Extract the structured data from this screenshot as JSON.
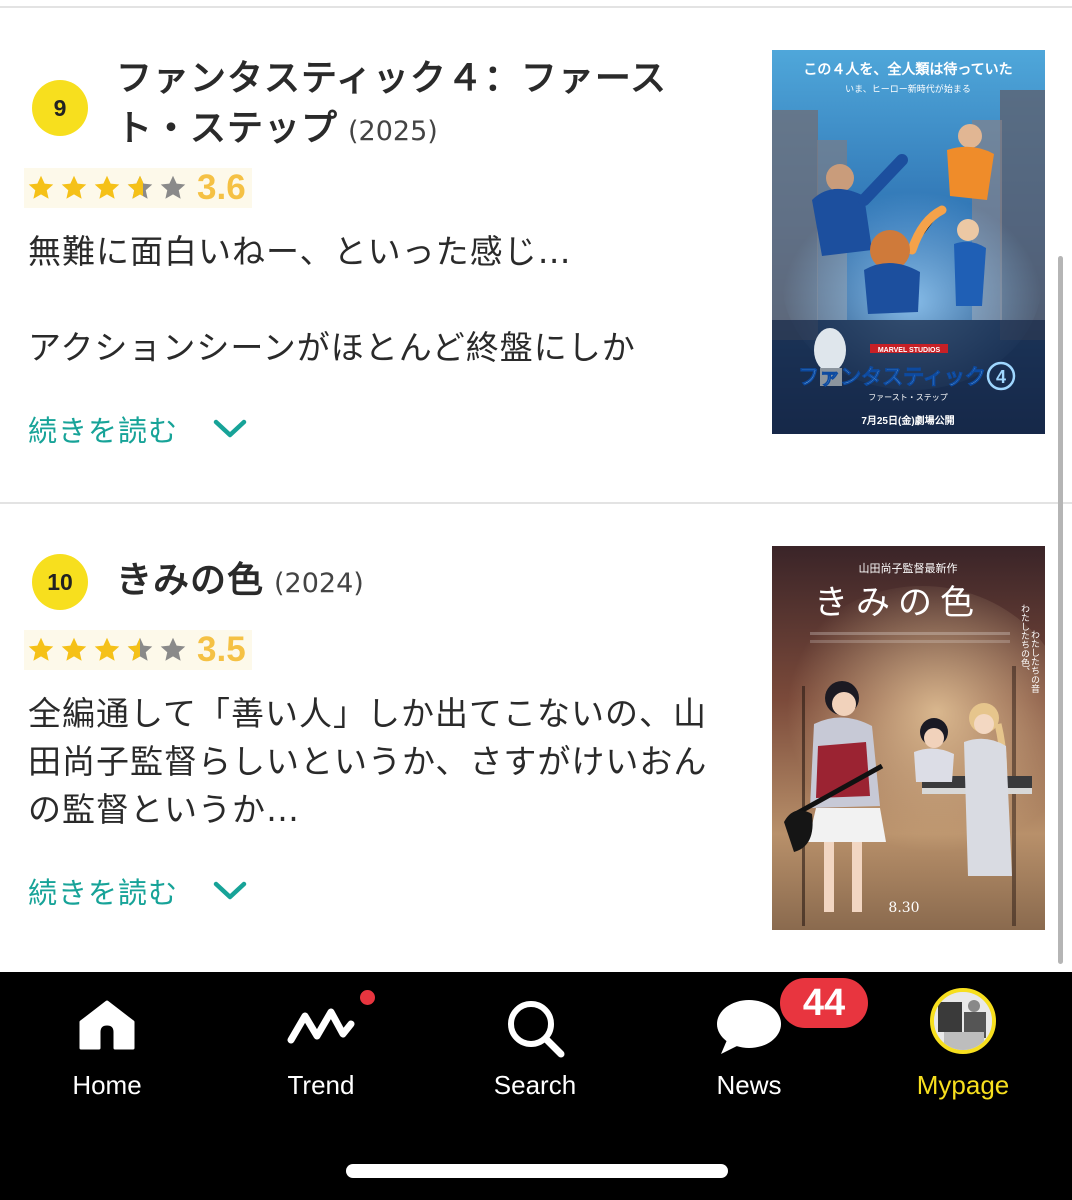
{
  "items": [
    {
      "rank": "9",
      "title": "ファンタスティック４：ファースト・ステップ",
      "year": "(2025)",
      "rating": {
        "score": "3.6",
        "value": 3.6,
        "max": 5
      },
      "review": "無難に面白いねー、といった感じ…\n\nアクションシーンがほとんど終盤にしか",
      "read_more": "続きを読む",
      "poster": {
        "tagline": "この４人を、全人類は待っていた",
        "subtagline": "いま、ヒーロー新時代が始まる",
        "brand": "MARVEL STUDIOS",
        "logo_text": "ファンタスティック",
        "logo_number": "4",
        "subtitle": "ファースト・ステップ",
        "release": "7月25日(金)劇場公開"
      }
    },
    {
      "rank": "10",
      "title": "きみの色",
      "year": "(2024)",
      "rating": {
        "score": "3.5",
        "value": 3.5,
        "max": 5
      },
      "review": "全編通して「善い人」しか出てこないの、山田尚子監督らしいというか、さすがけいおんの監督というか…",
      "read_more": "続きを読む",
      "poster": {
        "top_text": "山田尚子監督最新作",
        "title": "きみの色",
        "side_text_1": "わたしたちの色、",
        "side_text_2": "わたしたちの音",
        "date": "8.30"
      }
    }
  ],
  "tabbar": {
    "tabs": [
      {
        "label": "Home",
        "icon": "home-icon"
      },
      {
        "label": "Trend",
        "icon": "trend-icon"
      },
      {
        "label": "Search",
        "icon": "search-icon"
      },
      {
        "label": "News",
        "icon": "chat-bubble-icon"
      },
      {
        "label": "Mypage",
        "icon": "avatar"
      }
    ],
    "news_badge": "44",
    "active_tab": "Mypage"
  },
  "colors": {
    "accent_yellow": "#f7df1e",
    "star": "#f5c118",
    "star_empty": "#8a8a8a",
    "link_teal": "#17a398",
    "badge_red": "#e8353f"
  }
}
